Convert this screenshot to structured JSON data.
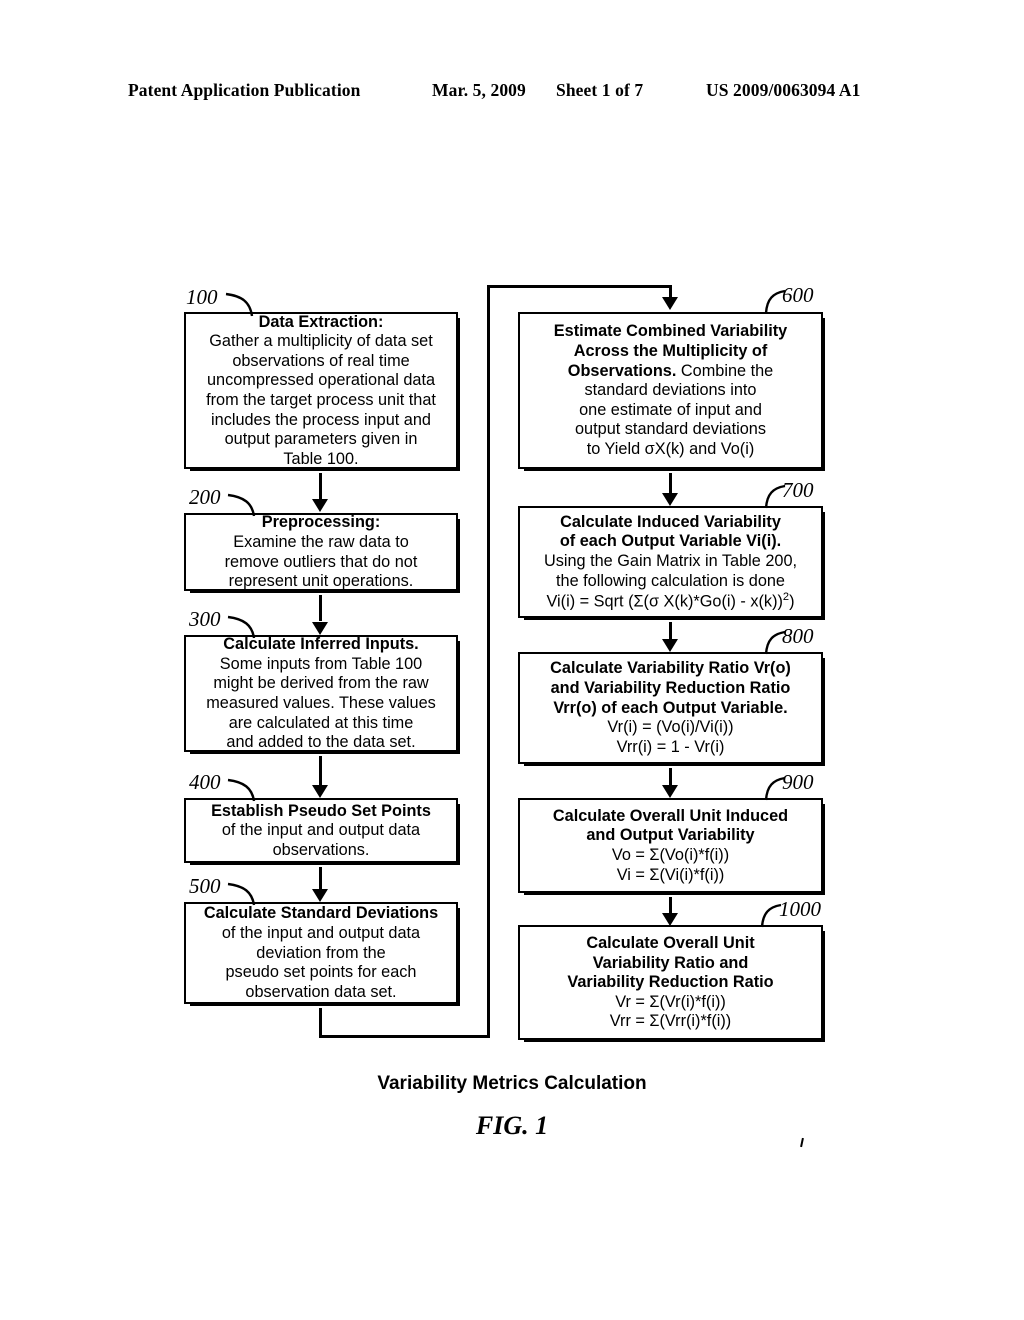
{
  "header": {
    "publication": "Patent Application Publication",
    "date": "Mar. 5, 2009",
    "sheet": "Sheet 1 of 7",
    "number": "US 2009/0063094 A1"
  },
  "figure": {
    "caption": "Variability Metrics Calculation",
    "label": "FIG. 1"
  },
  "left_column": [
    {
      "ref": "100",
      "title": "Data Extraction:",
      "lines": [
        "Gather a multiplicity of data set",
        "observations of real time",
        "uncompressed operational data",
        "from the target process unit that",
        "includes the process input and",
        "output parameters given in",
        "Table 100."
      ]
    },
    {
      "ref": "200",
      "title": "Preprocessing:",
      "lines": [
        "Examine the raw data to",
        "remove outliers that do not",
        "represent unit operations."
      ]
    },
    {
      "ref": "300",
      "title": "Calculate Inferred Inputs.",
      "lines": [
        "Some inputs from Table 100",
        "might be derived from the raw",
        "measured values. These values",
        "are calculated at this time",
        "and added to the data set."
      ]
    },
    {
      "ref": "400",
      "title": "Establish Pseudo Set Points",
      "lines": [
        "of the input and output data",
        "observations."
      ]
    },
    {
      "ref": "500",
      "title": "Calculate Standard Deviations",
      "lines": [
        "of the input and output data",
        "deviation from the",
        "pseudo set points for each",
        "observation data set."
      ]
    }
  ],
  "right_column": [
    {
      "ref": "600",
      "title_lines": [
        "Estimate Combined Variability",
        "Across the Multiplicity of",
        "Observations."
      ],
      "inline_after_title": " Combine the",
      "lines": [
        "standard deviations into",
        "one estimate of input and",
        "output standard deviations",
        "to Yield σX(k) and Vo(i)"
      ]
    },
    {
      "ref": "700",
      "title_lines": [
        "Calculate Induced Variability",
        "of each Output Variable Vi(i)."
      ],
      "lines": [
        "Using the Gain Matrix in Table 200,",
        "the following calculation is done"
      ],
      "formula_html": "Vi(i) = Sqrt (Σ(σ X(k)*Go(i) - x(k))<sup>2</sup>)"
    },
    {
      "ref": "800",
      "title_lines": [
        "Calculate Variability Ratio Vr(o)",
        "and Variability Reduction Ratio",
        "Vrr(o) of each Output Variable."
      ],
      "lines": [
        "Vr(i) = (Vo(i)/Vi(i))",
        "Vrr(i) = 1 - Vr(i)"
      ]
    },
    {
      "ref": "900",
      "title_lines": [
        "Calculate Overall Unit Induced",
        "and Output Variability"
      ],
      "lines": [
        "Vo = Σ(Vo(i)*f(i))",
        "Vi = Σ(Vi(i)*f(i))"
      ]
    },
    {
      "ref": "1000",
      "title_lines": [
        "Calculate Overall Unit",
        "Variability Ratio and",
        "Variability Reduction Ratio"
      ],
      "lines": [
        "Vr = Σ(Vr(i)*f(i))",
        "Vrr = Σ(Vrr(i)*f(i))"
      ]
    }
  ],
  "colors": {
    "ink": "#000000",
    "paper": "#ffffff"
  }
}
